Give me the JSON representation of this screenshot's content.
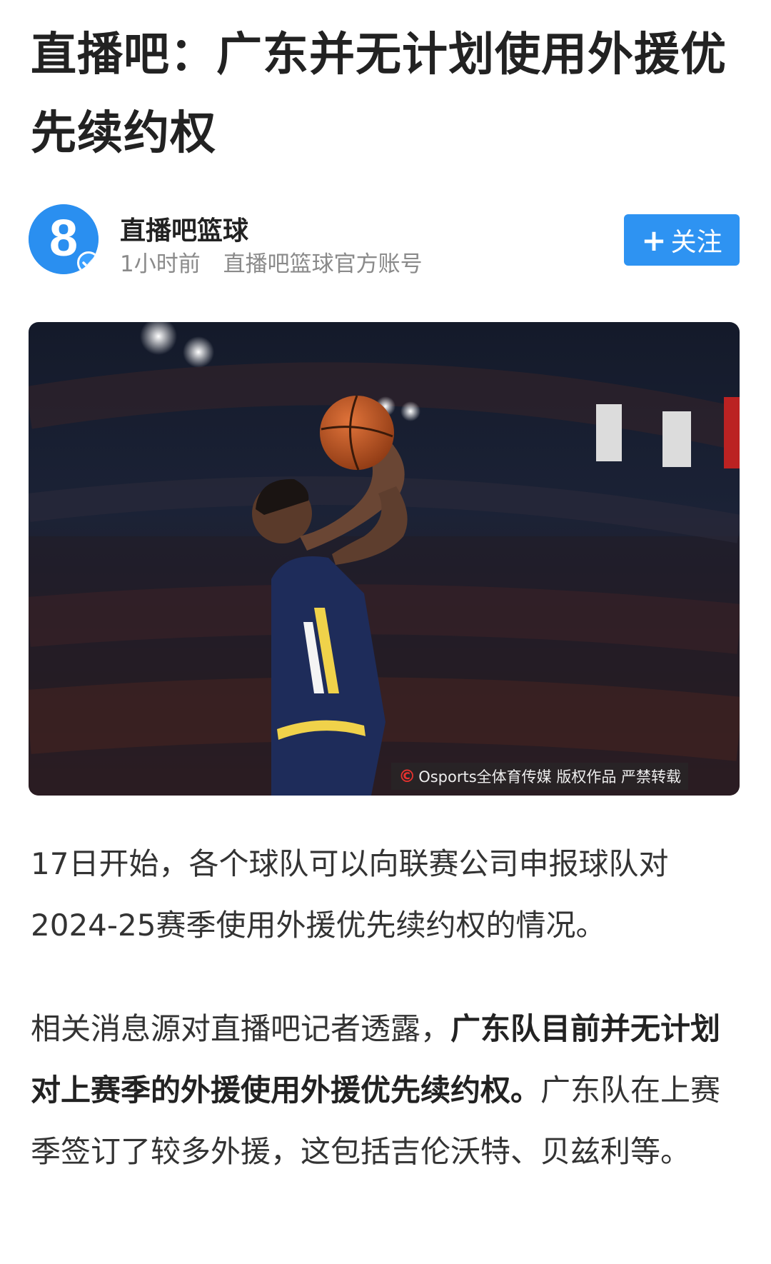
{
  "article": {
    "title": "直播吧：广东并无计划使用外援优先续约权"
  },
  "author": {
    "name": "直播吧篮球",
    "time": "1小时前",
    "account": "直播吧篮球官方账号",
    "avatar_icon": "eight-logo-icon",
    "verified_icon": "verified-check-icon"
  },
  "follow": {
    "plus": "+",
    "label": "关注"
  },
  "image": {
    "watermark_logo": "©",
    "watermark": "Osports全体育传媒  版权作品 严禁转载"
  },
  "body": {
    "p1": "17日开始，各个球队可以向联赛公司申报球队对2024-25赛季使用外援优先续约权的情况。",
    "p2_intro": "相关消息源对直播吧记者透露，",
    "p2_bold": "广东队目前并无计划对上赛季的外援使用外援优先续约权。",
    "p2_rest": "广东队在上赛季签订了较多外援，这包括吉伦沃特、贝兹利等。"
  },
  "colors": {
    "accent": "#2e93f2",
    "avatar": "#2a8ff0",
    "text": "#333333",
    "meta": "#8a8a8a"
  }
}
